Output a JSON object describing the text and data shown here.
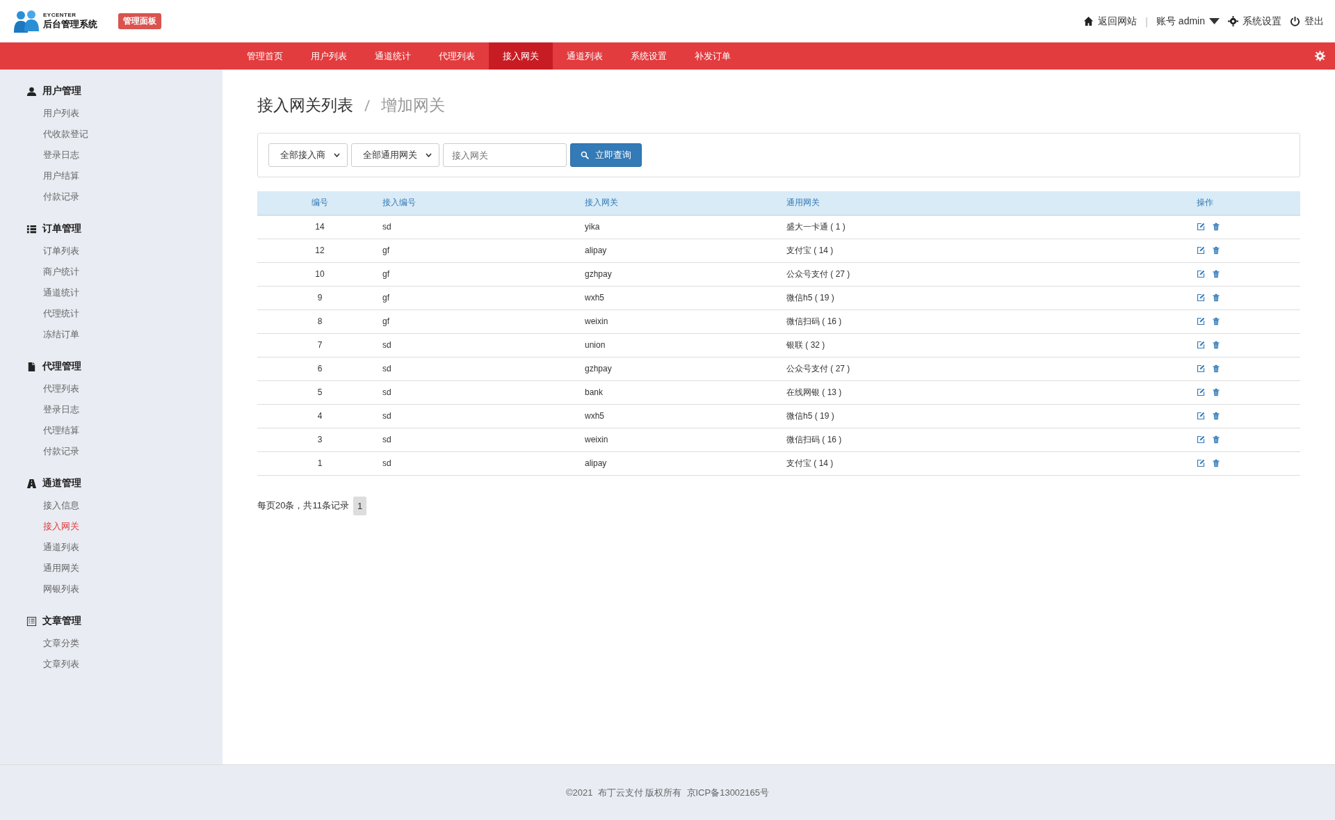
{
  "header": {
    "logo_caption": "EYCENTER",
    "logo_title": "后台管理系统",
    "badge": "管理面板",
    "separator": "|",
    "links": [
      {
        "kind": "home",
        "label": "返回网站"
      },
      {
        "kind": "account",
        "label": "账号 admin"
      },
      {
        "kind": "settings",
        "label": "系统设置"
      },
      {
        "kind": "logout",
        "label": "登出"
      }
    ]
  },
  "nav": {
    "items": [
      {
        "label": "管理首页",
        "selected": false
      },
      {
        "label": "用户列表",
        "selected": false
      },
      {
        "label": "通道统计",
        "selected": false
      },
      {
        "label": "代理列表",
        "selected": false
      },
      {
        "label": "接入网关",
        "selected": true
      },
      {
        "label": "通道列表",
        "selected": false
      },
      {
        "label": "系统设置",
        "selected": false
      },
      {
        "label": "补发订单",
        "selected": false
      }
    ]
  },
  "sidebar": {
    "groups": [
      {
        "title": "用户管理",
        "items": [
          {
            "label": "用户列表",
            "selected": false
          },
          {
            "label": "代收款登记",
            "selected": false
          },
          {
            "label": "登录日志",
            "selected": false
          },
          {
            "label": "用户结算",
            "selected": false
          },
          {
            "label": "付款记录",
            "selected": false
          }
        ]
      },
      {
        "title": "订单管理",
        "items": [
          {
            "label": "订单列表",
            "selected": false
          },
          {
            "label": "商户统计",
            "selected": false
          },
          {
            "label": "通道统计",
            "selected": false
          },
          {
            "label": "代理统计",
            "selected": false
          },
          {
            "label": "冻结订单",
            "selected": false
          }
        ]
      },
      {
        "title": "代理管理",
        "items": [
          {
            "label": "代理列表",
            "selected": false
          },
          {
            "label": "登录日志",
            "selected": false
          },
          {
            "label": "代理结算",
            "selected": false
          },
          {
            "label": "付款记录",
            "selected": false
          }
        ]
      },
      {
        "title": "通道管理",
        "items": [
          {
            "label": "接入信息",
            "selected": false
          },
          {
            "label": "接入网关",
            "selected": true
          },
          {
            "label": "通道列表",
            "selected": false
          },
          {
            "label": "通用网关",
            "selected": false
          },
          {
            "label": "网银列表",
            "selected": false
          }
        ]
      },
      {
        "title": "文章管理",
        "items": [
          {
            "label": "文章分类",
            "selected": false
          },
          {
            "label": "文章列表",
            "selected": false
          }
        ]
      }
    ]
  },
  "page": {
    "title": "接入网关列表",
    "subtitle": "增加网关"
  },
  "filters": {
    "select_1": "全部接入商",
    "select_2": "全部通用网关",
    "search": {
      "placeholder": "接入网关"
    },
    "button": "立即查询"
  },
  "table": {
    "columns": [
      "编号",
      "接入编号",
      "接入网关",
      "通用网关",
      "操作"
    ],
    "rows": [
      [
        "14",
        "sd",
        "yika",
        "盛大一卡通 ( 1 )"
      ],
      [
        "12",
        "gf",
        "alipay",
        "支付宝 ( 14 )"
      ],
      [
        "10",
        "gf",
        "gzhpay",
        "公众号支付 ( 27 )"
      ],
      [
        "9",
        "gf",
        "wxh5",
        "微信h5 ( 19 )"
      ],
      [
        "8",
        "gf",
        "weixin",
        "微信扫码 ( 16 )"
      ],
      [
        "7",
        "sd",
        "union",
        "银联 ( 32 )"
      ],
      [
        "6",
        "sd",
        "gzhpay",
        "公众号支付 ( 27 )"
      ],
      [
        "5",
        "sd",
        "bank",
        "在线网银 ( 13 )"
      ],
      [
        "4",
        "sd",
        "wxh5",
        "微信h5 ( 19 )"
      ],
      [
        "3",
        "sd",
        "weixin",
        "微信扫码 ( 16 )"
      ],
      [
        "1",
        "sd",
        "alipay",
        "支付宝 ( 14 )"
      ]
    ]
  },
  "pagination": {
    "summary": "每页20条，共11条记录",
    "pages": [
      {
        "label": "1",
        "selected": true
      }
    ]
  },
  "footer": {
    "text": "©2021  布丁云支付 版权所有  京ICP备13002165号"
  }
}
